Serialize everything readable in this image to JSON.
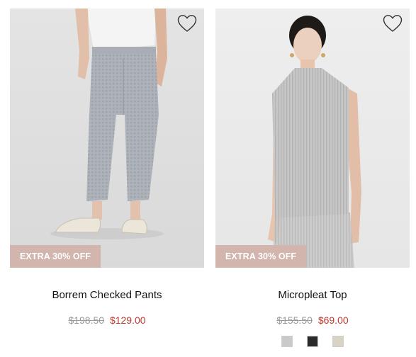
{
  "products": [
    {
      "name": "Borrem Checked Pants",
      "promo": "EXTRA 30% OFF",
      "price_original": "$198.50",
      "price_sale": "$129.00",
      "image": "model wearing grey checked cropped pants",
      "wishlist_icon": "heart-outline-icon",
      "swatches": []
    },
    {
      "name": "Micropleat Top",
      "promo": "EXTRA 30% OFF",
      "price_original": "$155.50",
      "price_sale": "$69.00",
      "image": "model wearing silver micropleat sleeveless top",
      "wishlist_icon": "heart-outline-icon",
      "swatches": [
        {
          "color": "#c9c9c7"
        },
        {
          "color": "#2a2a2a"
        },
        {
          "color": "#d9d3c6"
        }
      ]
    }
  ],
  "colors": {
    "promo_bg": "#d2b5ad",
    "sale_price": "#c0392b",
    "strike_price": "#9a9a9a"
  }
}
